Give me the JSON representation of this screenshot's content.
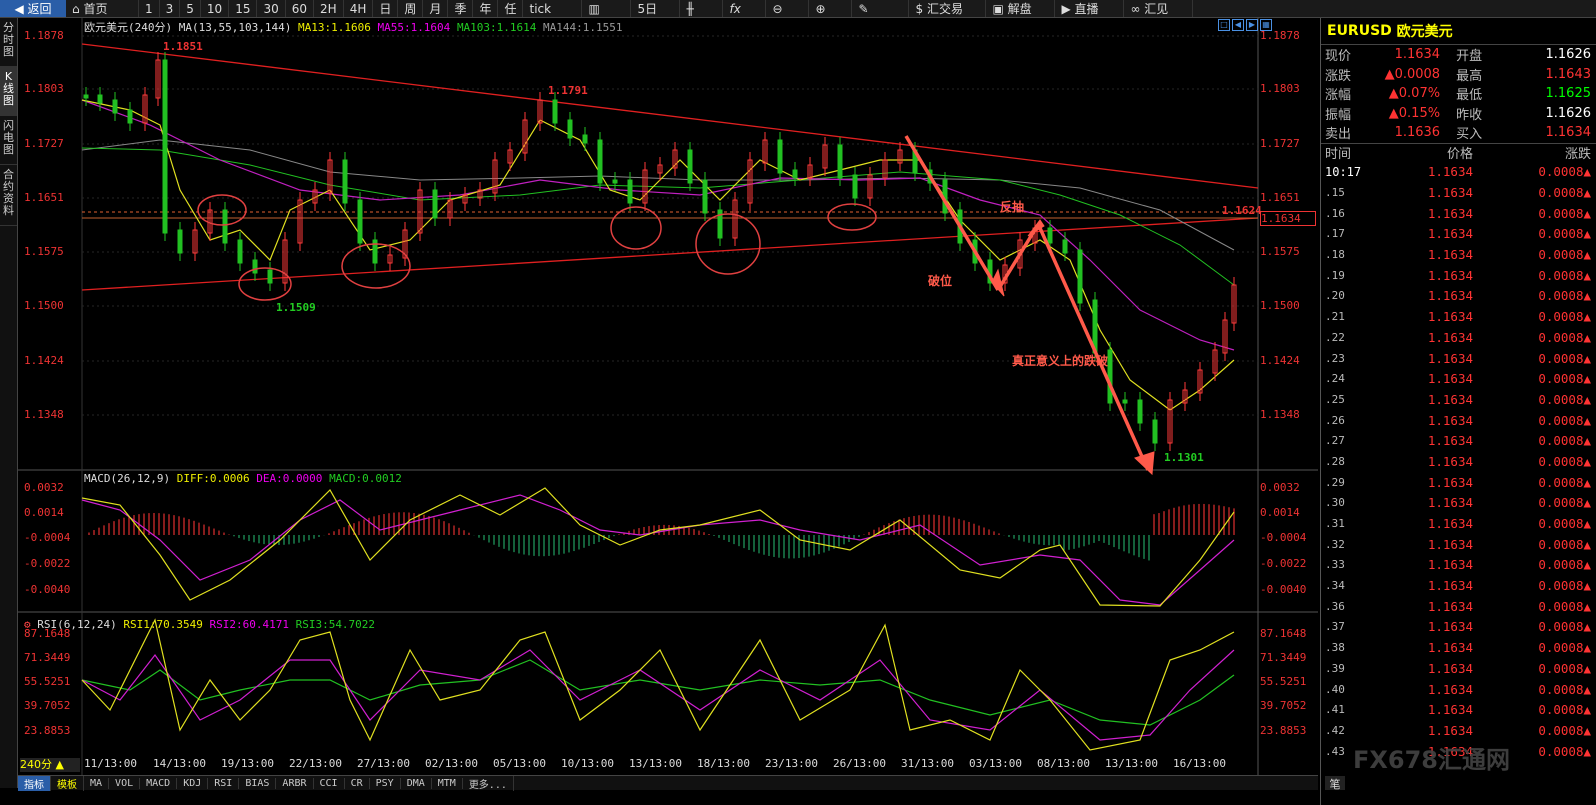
{
  "toolbar": {
    "back": "返回",
    "home": "首页",
    "periods": [
      "1",
      "3",
      "5",
      "10",
      "15",
      "30",
      "60",
      "2H",
      "4H",
      "日",
      "周",
      "月",
      "季",
      "年",
      "任",
      "tick"
    ],
    "five_day": "5日",
    "exchange": "汇交易",
    "analysis": "解盘",
    "live": "直播",
    "summary": "汇见"
  },
  "leftbar": [
    "分时图",
    "K线图",
    "闪电图",
    "合约资料"
  ],
  "main_header": {
    "name": "欧元美元",
    "period": "(240分)",
    "ma": "MA(13,55,103,144)",
    "ma13": "MA13:1.1606",
    "ma55": "MA55:1.1604",
    "ma103": "MA103:1.1614",
    "ma144": "MA144:1.1551"
  },
  "price_axis": [
    "1.1878",
    "1.1803",
    "1.1727",
    "1.1651",
    "1.1575",
    "1.1500",
    "1.1424",
    "1.1348"
  ],
  "annotations": {
    "high1": "1.1851",
    "high2": "1.1791",
    "low1": "1.1509",
    "low2": "1.1301",
    "current": "1.1624",
    "current_box": "1.1634",
    "break": "破位",
    "rebound": "反抽",
    "real_drop": "真正意义上的跌破"
  },
  "macd_header": {
    "title": "MACD(26,12,9)",
    "diff": "DIFF:0.0006",
    "dea": "DEA:0.0000",
    "macd": "MACD:0.0012"
  },
  "macd_axis": [
    "0.0032",
    "0.0014",
    "-0.0004",
    "-0.0022",
    "-0.0040"
  ],
  "rsi_header": {
    "title": "RSI(6,12,24)",
    "rsi1": "RSI1:70.3549",
    "rsi2": "RSI2:60.4171",
    "rsi3": "RSI3:54.7022"
  },
  "rsi_axis": [
    "87.1648",
    "71.3449",
    "55.5251",
    "39.7052",
    "23.8853"
  ],
  "dates": [
    "11/13:00",
    "14/13:00",
    "19/13:00",
    "22/13:00",
    "27/13:00",
    "02/13:00",
    "05/13:00",
    "10/13:00",
    "13/13:00",
    "18/13:00",
    "23/13:00",
    "26/13:00",
    "31/13:00",
    "03/13:00",
    "08/13:00",
    "13/13:00",
    "16/13:00"
  ],
  "period_label": "240分",
  "bottom_tabs": [
    "指标",
    "模板",
    "MA",
    "VOL",
    "MACD",
    "KDJ",
    "RSI",
    "BIAS",
    "ARBR",
    "CCI",
    "CR",
    "PSY",
    "DMA",
    "MTM",
    "更多..."
  ],
  "quote": {
    "symbol": "EURUSD",
    "name": "欧元美元",
    "rows": [
      {
        "l1": "现价",
        "v1": "1.1634",
        "l2": "开盘",
        "v2": "1.1626"
      },
      {
        "l1": "涨跌",
        "v1": "0.0008",
        "l2": "最高",
        "v2": "1.1643"
      },
      {
        "l1": "涨幅",
        "v1": "0.07%",
        "l2": "最低",
        "v2": "1.1625"
      },
      {
        "l1": "振幅",
        "v1": "0.15%",
        "l2": "昨收",
        "v2": "1.1626"
      },
      {
        "l1": "卖出",
        "v1": "1.1636",
        "l2": "买入",
        "v2": "1.1634"
      }
    ]
  },
  "ticks": {
    "head_time": "时间",
    "head_price": "价格",
    "head_change": "涨跌",
    "rows": [
      {
        "t": "10:17",
        "p": "1.1634",
        "c": "0.0008"
      },
      {
        "t": ".15",
        "p": "1.1634",
        "c": "0.0008"
      },
      {
        "t": ".16",
        "p": "1.1634",
        "c": "0.0008"
      },
      {
        "t": ".17",
        "p": "1.1634",
        "c": "0.0008"
      },
      {
        "t": ".18",
        "p": "1.1634",
        "c": "0.0008"
      },
      {
        "t": ".19",
        "p": "1.1634",
        "c": "0.0008"
      },
      {
        "t": ".20",
        "p": "1.1634",
        "c": "0.0008"
      },
      {
        "t": ".21",
        "p": "1.1634",
        "c": "0.0008"
      },
      {
        "t": ".22",
        "p": "1.1634",
        "c": "0.0008"
      },
      {
        "t": ".23",
        "p": "1.1634",
        "c": "0.0008"
      },
      {
        "t": ".24",
        "p": "1.1634",
        "c": "0.0008"
      },
      {
        "t": ".25",
        "p": "1.1634",
        "c": "0.0008"
      },
      {
        "t": ".26",
        "p": "1.1634",
        "c": "0.0008"
      },
      {
        "t": ".27",
        "p": "1.1634",
        "c": "0.0008"
      },
      {
        "t": ".28",
        "p": "1.1634",
        "c": "0.0008"
      },
      {
        "t": ".29",
        "p": "1.1634",
        "c": "0.0008"
      },
      {
        "t": ".30",
        "p": "1.1634",
        "c": "0.0008"
      },
      {
        "t": ".31",
        "p": "1.1634",
        "c": "0.0008"
      },
      {
        "t": ".32",
        "p": "1.1634",
        "c": "0.0008"
      },
      {
        "t": ".33",
        "p": "1.1634",
        "c": "0.0008"
      },
      {
        "t": ".34",
        "p": "1.1634",
        "c": "0.0008"
      },
      {
        "t": ".36",
        "p": "1.1634",
        "c": "0.0008"
      },
      {
        "t": ".37",
        "p": "1.1634",
        "c": "0.0008"
      },
      {
        "t": ".38",
        "p": "1.1634",
        "c": "0.0008"
      },
      {
        "t": ".39",
        "p": "1.1634",
        "c": "0.0008"
      },
      {
        "t": ".40",
        "p": "1.1634",
        "c": "0.0008"
      },
      {
        "t": ".41",
        "p": "1.1634",
        "c": "0.0008"
      },
      {
        "t": ".42",
        "p": "1.1634",
        "c": "0.0008"
      },
      {
        "t": ".43",
        "p": "1.1634",
        "c": "0.0008"
      }
    ]
  },
  "watermark": "FX678汇通网",
  "pen": "笔"
}
